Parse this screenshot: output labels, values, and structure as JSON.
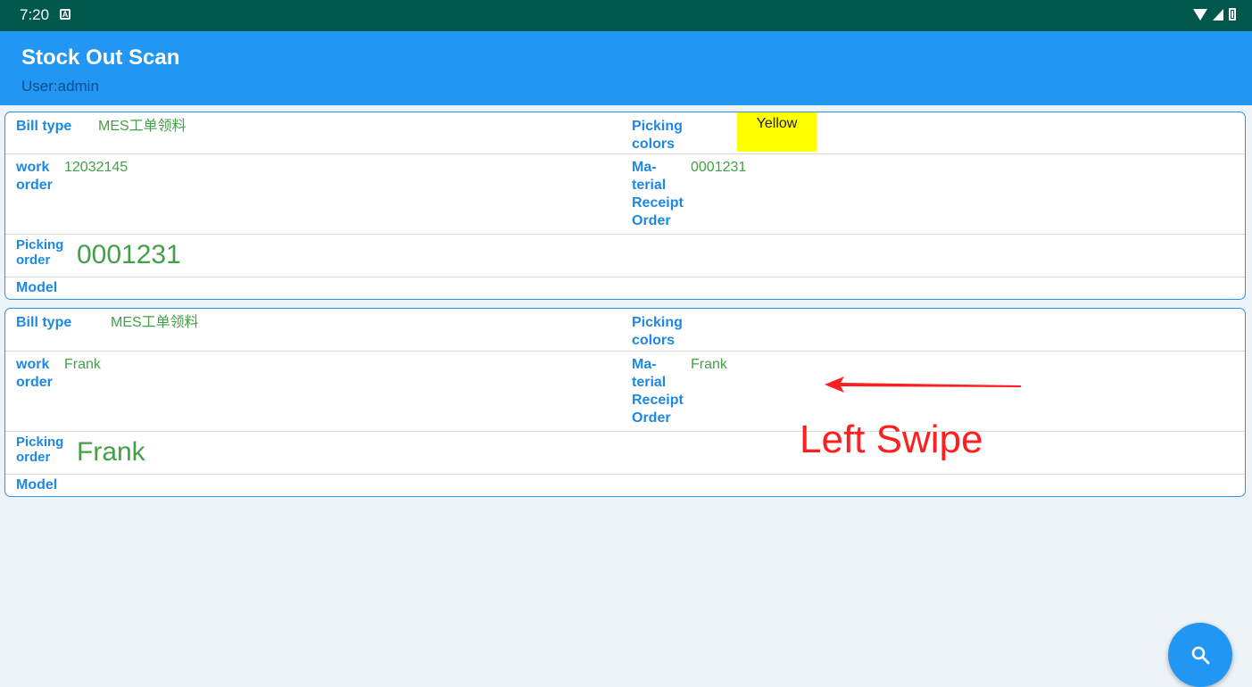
{
  "status_bar": {
    "time": "7:20",
    "notification_icon": "a-box-icon",
    "icons": [
      "wifi-icon",
      "signal-icon",
      "battery-icon"
    ]
  },
  "app_bar": {
    "title": "Stock Out Scan",
    "subtitle": "User:admin"
  },
  "cards": [
    {
      "bill_type_label": "Bill type",
      "bill_type_value": "MES工单领料",
      "picking_colors_label": [
        "Picking",
        "colors"
      ],
      "picking_colors_value": "Yellow",
      "work_order_label": [
        "work",
        "order"
      ],
      "work_order_value": "12032145",
      "material_receipt_label": [
        "Ma-",
        "terial",
        "Receipt",
        "Order"
      ],
      "material_receipt_value": "0001231",
      "picking_order_label": [
        "Picking",
        "order"
      ],
      "picking_order_value": "0001231",
      "model_label": "Model"
    },
    {
      "bill_type_label": "Bill type",
      "bill_type_value": "MES工单领料",
      "picking_colors_label": [
        "Picking",
        "colors"
      ],
      "picking_colors_value": "",
      "work_order_label": [
        "work",
        "order"
      ],
      "work_order_value": "Frank",
      "material_receipt_label": [
        "Ma-",
        "terial",
        "Receipt",
        "Order"
      ],
      "material_receipt_value": "Frank",
      "picking_order_label": [
        "Picking",
        "order"
      ],
      "picking_order_value": "Frank",
      "model_label": "Model"
    }
  ],
  "annotation": {
    "text": "Left Swipe",
    "color": "#ff1f1f"
  },
  "fab": {
    "icon": "search-icon"
  },
  "colors": {
    "primary": "#2196f3",
    "status_bar": "#00574b",
    "label": "#1e88e5",
    "value": "#43a047",
    "picking_color_box": "#ffff00"
  }
}
